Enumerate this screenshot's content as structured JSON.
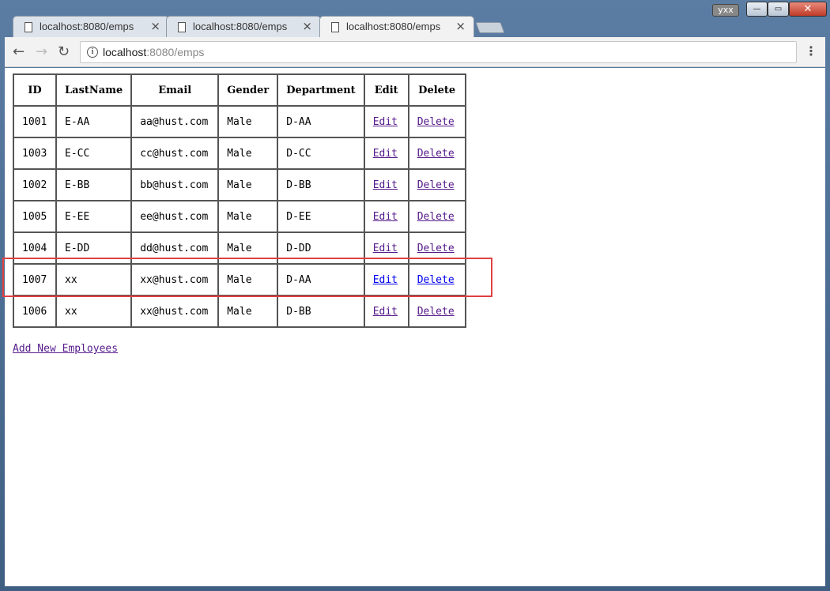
{
  "window": {
    "user": "yxx",
    "min": "—",
    "max": "▭",
    "close": "✕"
  },
  "tabs": [
    {
      "title": "localhost:8080/emps",
      "close": "×"
    },
    {
      "title": "localhost:8080/emps",
      "close": "×"
    },
    {
      "title": "localhost:8080/emps",
      "close": "×"
    }
  ],
  "toolbar": {
    "back": "←",
    "forward": "→",
    "reload": "↻",
    "url_host": "localhost",
    "url_path": ":8080/emps",
    "bookmark": "☆",
    "menu": "⋮"
  },
  "table": {
    "headers": [
      "ID",
      "LastName",
      "Email",
      "Gender",
      "Department",
      "Edit",
      "Delete"
    ],
    "rows": [
      [
        "1001",
        "E-AA",
        "aa@hust.com",
        "Male",
        "D-AA",
        "Edit",
        "Delete"
      ],
      [
        "1003",
        "E-CC",
        "cc@hust.com",
        "Male",
        "D-CC",
        "Edit",
        "Delete"
      ],
      [
        "1002",
        "E-BB",
        "bb@hust.com",
        "Male",
        "D-BB",
        "Edit",
        "Delete"
      ],
      [
        "1005",
        "E-EE",
        "ee@hust.com",
        "Male",
        "D-EE",
        "Edit",
        "Delete"
      ],
      [
        "1004",
        "E-DD",
        "dd@hust.com",
        "Male",
        "D-DD",
        "Edit",
        "Delete"
      ],
      [
        "1007",
        "xx",
        "xx@hust.com",
        "Male",
        "D-AA",
        "Edit",
        "Delete"
      ],
      [
        "1006",
        "xx",
        "xx@hust.com",
        "Male",
        "D-BB",
        "Edit",
        "Delete"
      ]
    ]
  },
  "add_link": "Add New Employees",
  "colors": {
    "link_visited": "#551a8b",
    "link": "#0000ee",
    "highlight": "#e04040"
  }
}
